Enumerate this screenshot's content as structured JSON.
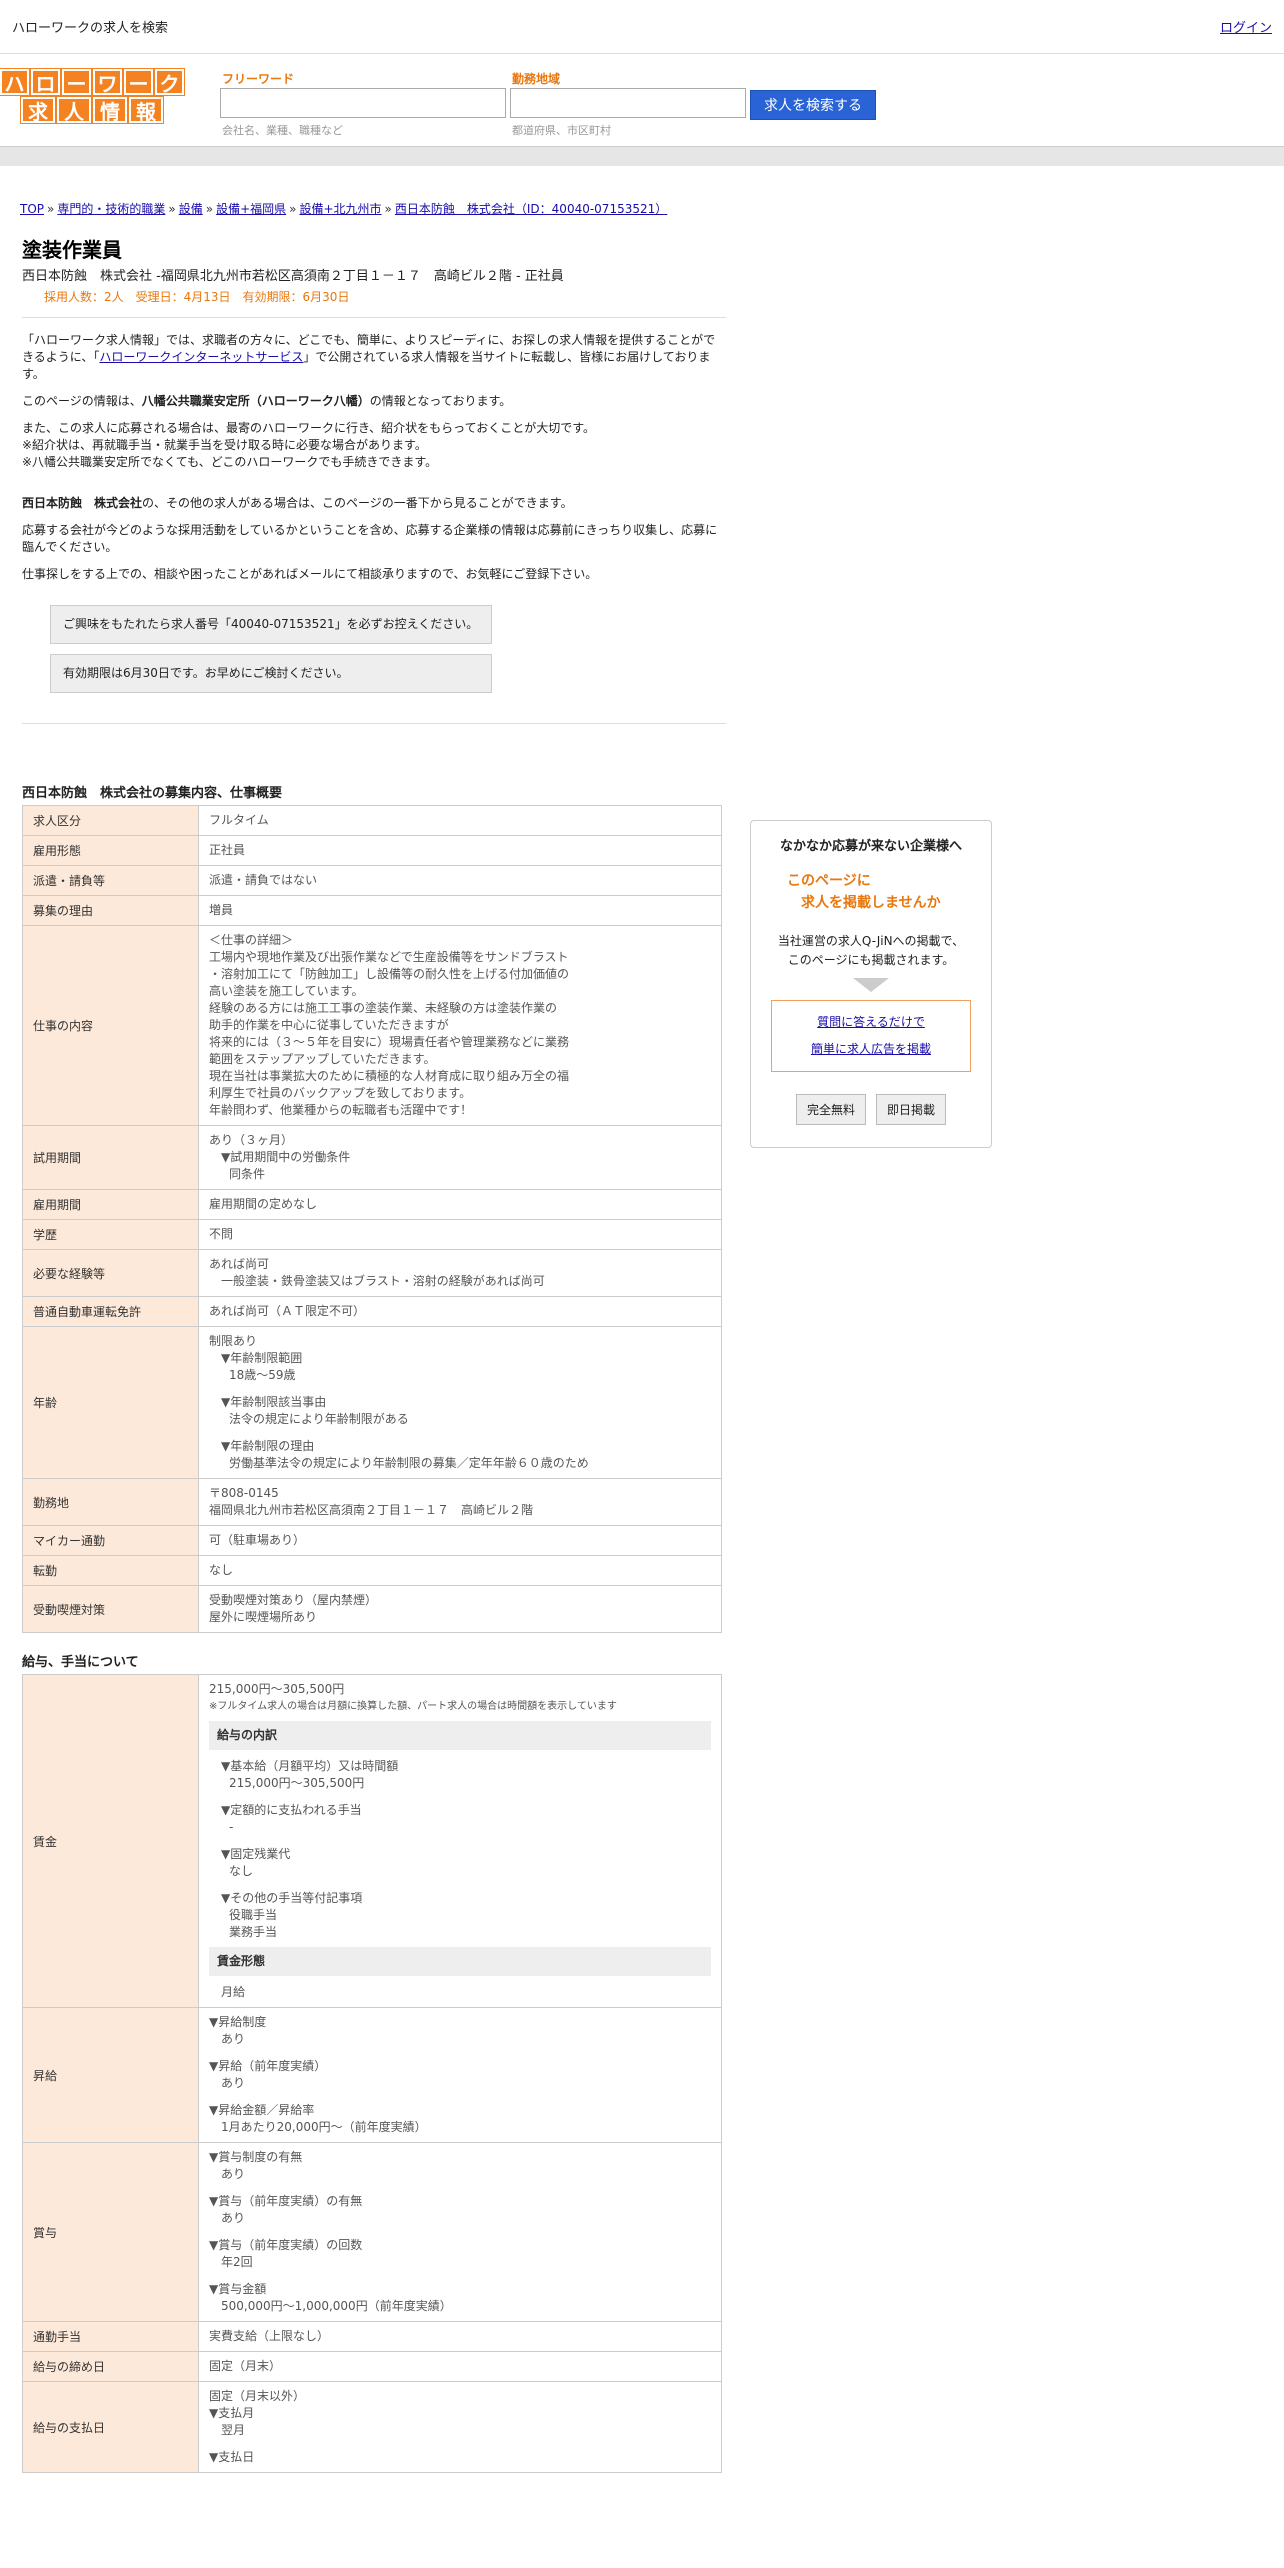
{
  "topbar": {
    "site_title": "ハローワークの求人を検索",
    "login": "ログイン"
  },
  "logo": {
    "row1": [
      "ハ",
      "ロ",
      "ー",
      "ワ",
      "ー",
      "ク"
    ],
    "row2": [
      "求",
      "人",
      "情",
      "報"
    ]
  },
  "search": {
    "keyword_label": "フリーワード",
    "keyword_hint": "会社名、業種、職種など",
    "area_label": "勤務地域",
    "area_hint": "都道府県、市区町村",
    "button": "求人を検索する"
  },
  "breadcrumb": [
    "TOP",
    "専門的・技術的職業",
    "設備",
    "設備+福岡県",
    "設備+北九州市",
    "西日本防蝕　株式会社（ID：40040-07153521）"
  ],
  "job": {
    "title": "塗装作業員",
    "subtitle": "西日本防蝕　株式会社 -福岡県北九州市若松区高須南２丁目１－１７　高崎ビル２階 - 正社員",
    "meta": "採用人数：2人　受理日：4月13日　有効期限：6月30日"
  },
  "intro": {
    "p1a": "「ハローワーク求人情報」では、求職者の方々に、どこでも、簡単に、よりスピーディに、お探しの求人情報を提供することができるように、「",
    "p1link": "ハローワークインターネットサービス",
    "p1b": "」で公開されている求人情報を当サイトに転載し、皆様にお届けしております。",
    "p2a": "このページの情報は、",
    "p2b": "八幡公共職業安定所（ハローワーク八幡）",
    "p2c": "の情報となっております。",
    "p3": "また、この求人に応募される場合は、最寄のハローワークに行き、紹介状をもらっておくことが大切です。",
    "p3b": "※紹介状は、再就職手当・就業手当を受け取る時に必要な場合があります。",
    "p3c": "※八幡公共職業安定所でなくても、どこのハローワークでも手続きできます。",
    "p4a": "西日本防蝕　株式会社",
    "p4b": "の、その他の求人がある場合は、このページの一番下から見ることができます。",
    "p5": "応募する会社が今どのような採用活動をしているかということを含め、応募する企業様の情報は応募前にきっちり収集し、応募に臨んでください。",
    "p6": "仕事探しをする上での、相談や困ったことがあればメールにて相談承りますので、お気軽にご登録下さい。"
  },
  "notices": [
    "ご興味をもたれたら求人番号「40040-07153521」を必ずお控えください。",
    "有効期限は6月30日です。お早めにご検討ください。"
  ],
  "sec1": {
    "title": "西日本防蝕　株式会社の募集内容、仕事概要",
    "rows": {
      "kubun": [
        "求人区分",
        "フルタイム"
      ],
      "keitai": [
        "雇用形態",
        "正社員"
      ],
      "haken": [
        "派遣・請負等",
        "派遣・請負ではない"
      ],
      "riyu": [
        "募集の理由",
        "増員"
      ],
      "naiyo_label": "仕事の内容",
      "naiyo": [
        "＜仕事の詳細＞",
        "工場内や現地作業及び出張作業などで生産設備等をサンドブラスト",
        "・溶射加工にて「防蝕加工」し設備等の耐久性を上げる付加価値の",
        "高い塗装を施工しています。",
        "経験のある方には施工工事の塗装作業、未経験の方は塗装作業の",
        "助手的作業を中心に従事していただきますが",
        "将来的には（３～５年を目安に）現場責任者や管理業務などに業務",
        "範囲をステップアップしていただきます。",
        "現在当社は事業拡大のために積極的な人材育成に取り組み万全の福",
        "利厚生で社員のバックアップを致しております。",
        "年齢問わず、他業種からの転職者も活躍中です！"
      ],
      "shiyo_label": "試用期間",
      "shiyo": [
        "あり（３ヶ月）",
        "▼試用期間中の労働条件",
        "同条件"
      ],
      "kikan": [
        "雇用期間",
        "雇用期間の定めなし"
      ],
      "gakureki": [
        "学歴",
        "不問"
      ],
      "keiken_label": "必要な経験等",
      "keiken": [
        "あれば尚可",
        "一般塗装・鉄骨塗装又はブラスト・溶射の経験があれば尚可"
      ],
      "menkyo": [
        "普通自動車運転免許",
        "あれば尚可（ＡＴ限定不可）"
      ],
      "nenrei_label": "年齢",
      "nenrei": [
        "制限あり",
        "▼年齢制限範囲",
        "18歳〜59歳",
        "▼年齢制限該当事由",
        "法令の規定により年齢制限がある",
        "▼年齢制限の理由",
        "労働基準法令の規定により年齢制限の募集／定年年齢６０歳のため"
      ],
      "kinmuchi_label": "勤務地",
      "kinmuchi": [
        "〒808-0145",
        "福岡県北九州市若松区高須南２丁目１－１７　高崎ビル２階"
      ],
      "mycar": [
        "マイカー通勤",
        "可（駐車場あり）"
      ],
      "tenkin": [
        "転勤",
        "なし"
      ],
      "kitsuen_label": "受動喫煙対策",
      "kitsuen": [
        "受動喫煙対策あり（屋内禁煙）",
        "屋外に喫煙場所あり"
      ]
    }
  },
  "sec2": {
    "title": "給与、手当について",
    "chingin_label": "賃金",
    "chingin": {
      "range": "215,000円〜305,500円",
      "note": "※フルタイム求人の場合は月額に換算した額、パート求人の場合は時間額を表示しています",
      "uchiwake": "給与の内訳",
      "items": [
        "▼基本給（月額平均）又は時間額",
        "215,000円〜305,500円",
        "▼定額的に支払われる手当",
        "-",
        "▼固定残業代",
        "なし",
        "▼その他の手当等付記事項",
        "役職手当",
        "業務手当"
      ],
      "keitai_head": "賃金形態",
      "keitai": "月給"
    },
    "shokyu_label": "昇給",
    "shokyu": [
      "▼昇給制度",
      "あり",
      "▼昇給（前年度実績）",
      "あり",
      "▼昇給金額／昇給率",
      "1月あたり20,000円〜（前年度実績）"
    ],
    "shoyo_label": "賞与",
    "shoyo": [
      "▼賞与制度の有無",
      "あり",
      "▼賞与（前年度実績）の有無",
      "あり",
      "▼賞与（前年度実績）の回数",
      "年2回",
      "▼賞与金額",
      "500,000円〜1,000,000円（前年度実績）"
    ],
    "tsukin": [
      "通勤手当",
      "実費支給（上限なし）"
    ],
    "shimebi": [
      "給与の締め日",
      "固定（月末）"
    ],
    "shiharai_label": "給与の支払日",
    "shiharai": [
      "固定（月末以外）",
      "▼支払月",
      "翌月",
      "▼支払日"
    ]
  },
  "ad": {
    "title": "なかなか応募が来ない企業様へ",
    "catch1": "このページに",
    "catch2": "求人を掲載しませんか",
    "text1": "当社運営の求人Q-JiNへの掲載で、",
    "text2": "このページにも掲載されます。",
    "link1": "質問に答えるだけで",
    "link2": "簡単に求人広告を掲載",
    "btn1": "完全無料",
    "btn2": "即日掲載"
  }
}
